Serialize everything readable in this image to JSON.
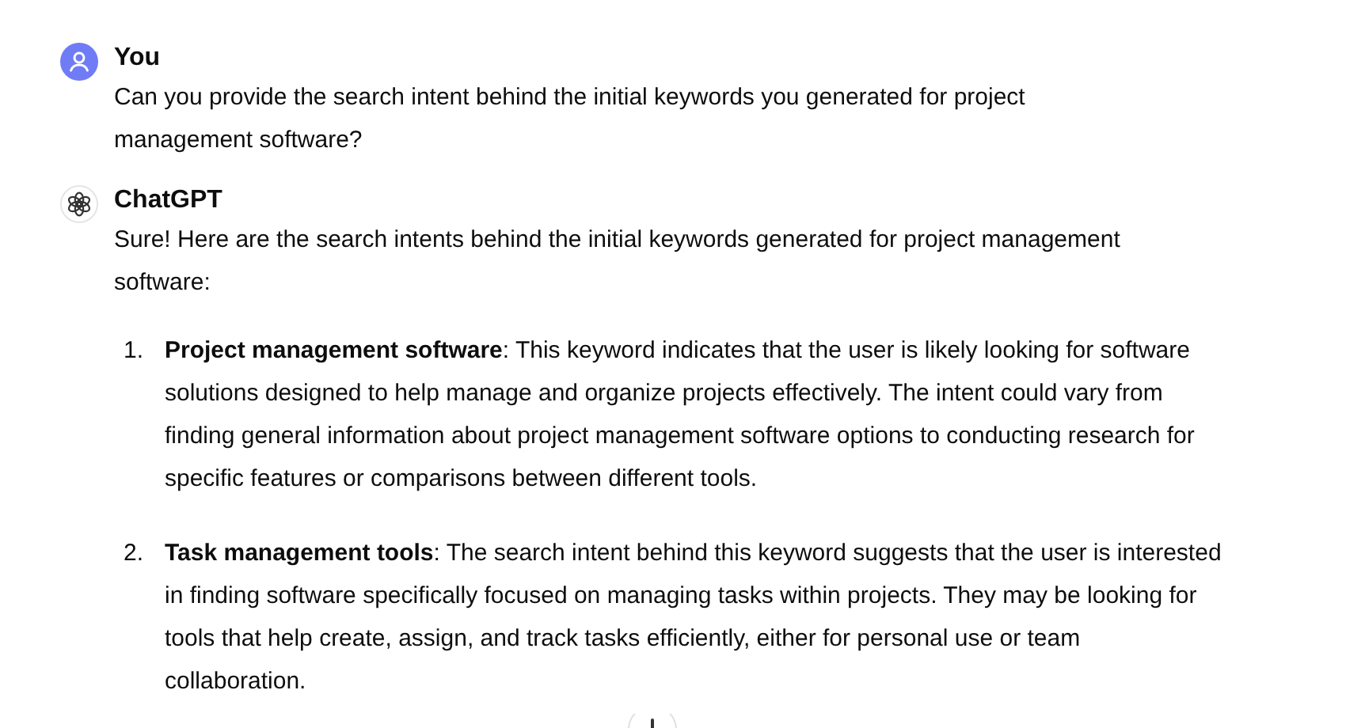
{
  "messages": [
    {
      "kind": "user",
      "author": "You",
      "text": "Can you provide the search intent behind the initial keywords you generated for project management software?"
    },
    {
      "kind": "assistant",
      "author": "ChatGPT",
      "text": "Sure! Here are the search intents behind the initial keywords generated for project management software:",
      "list": [
        {
          "number": "1.",
          "text": "**Project management software**: This keyword indicates that the user is likely looking for software solutions designed to help manage and organize projects effectively. The intent could vary from finding general information about project management software options to conducting research for specific features or comparisons between different tools."
        },
        {
          "number": "2.",
          "text": "**Task management tools**: The search intent behind this keyword suggests that the user is interested in finding software specifically focused on managing tasks within projects. They may be looking for tools that help create, assign, and track tasks efficiently, either for personal use or team collaboration."
        }
      ]
    }
  ]
}
